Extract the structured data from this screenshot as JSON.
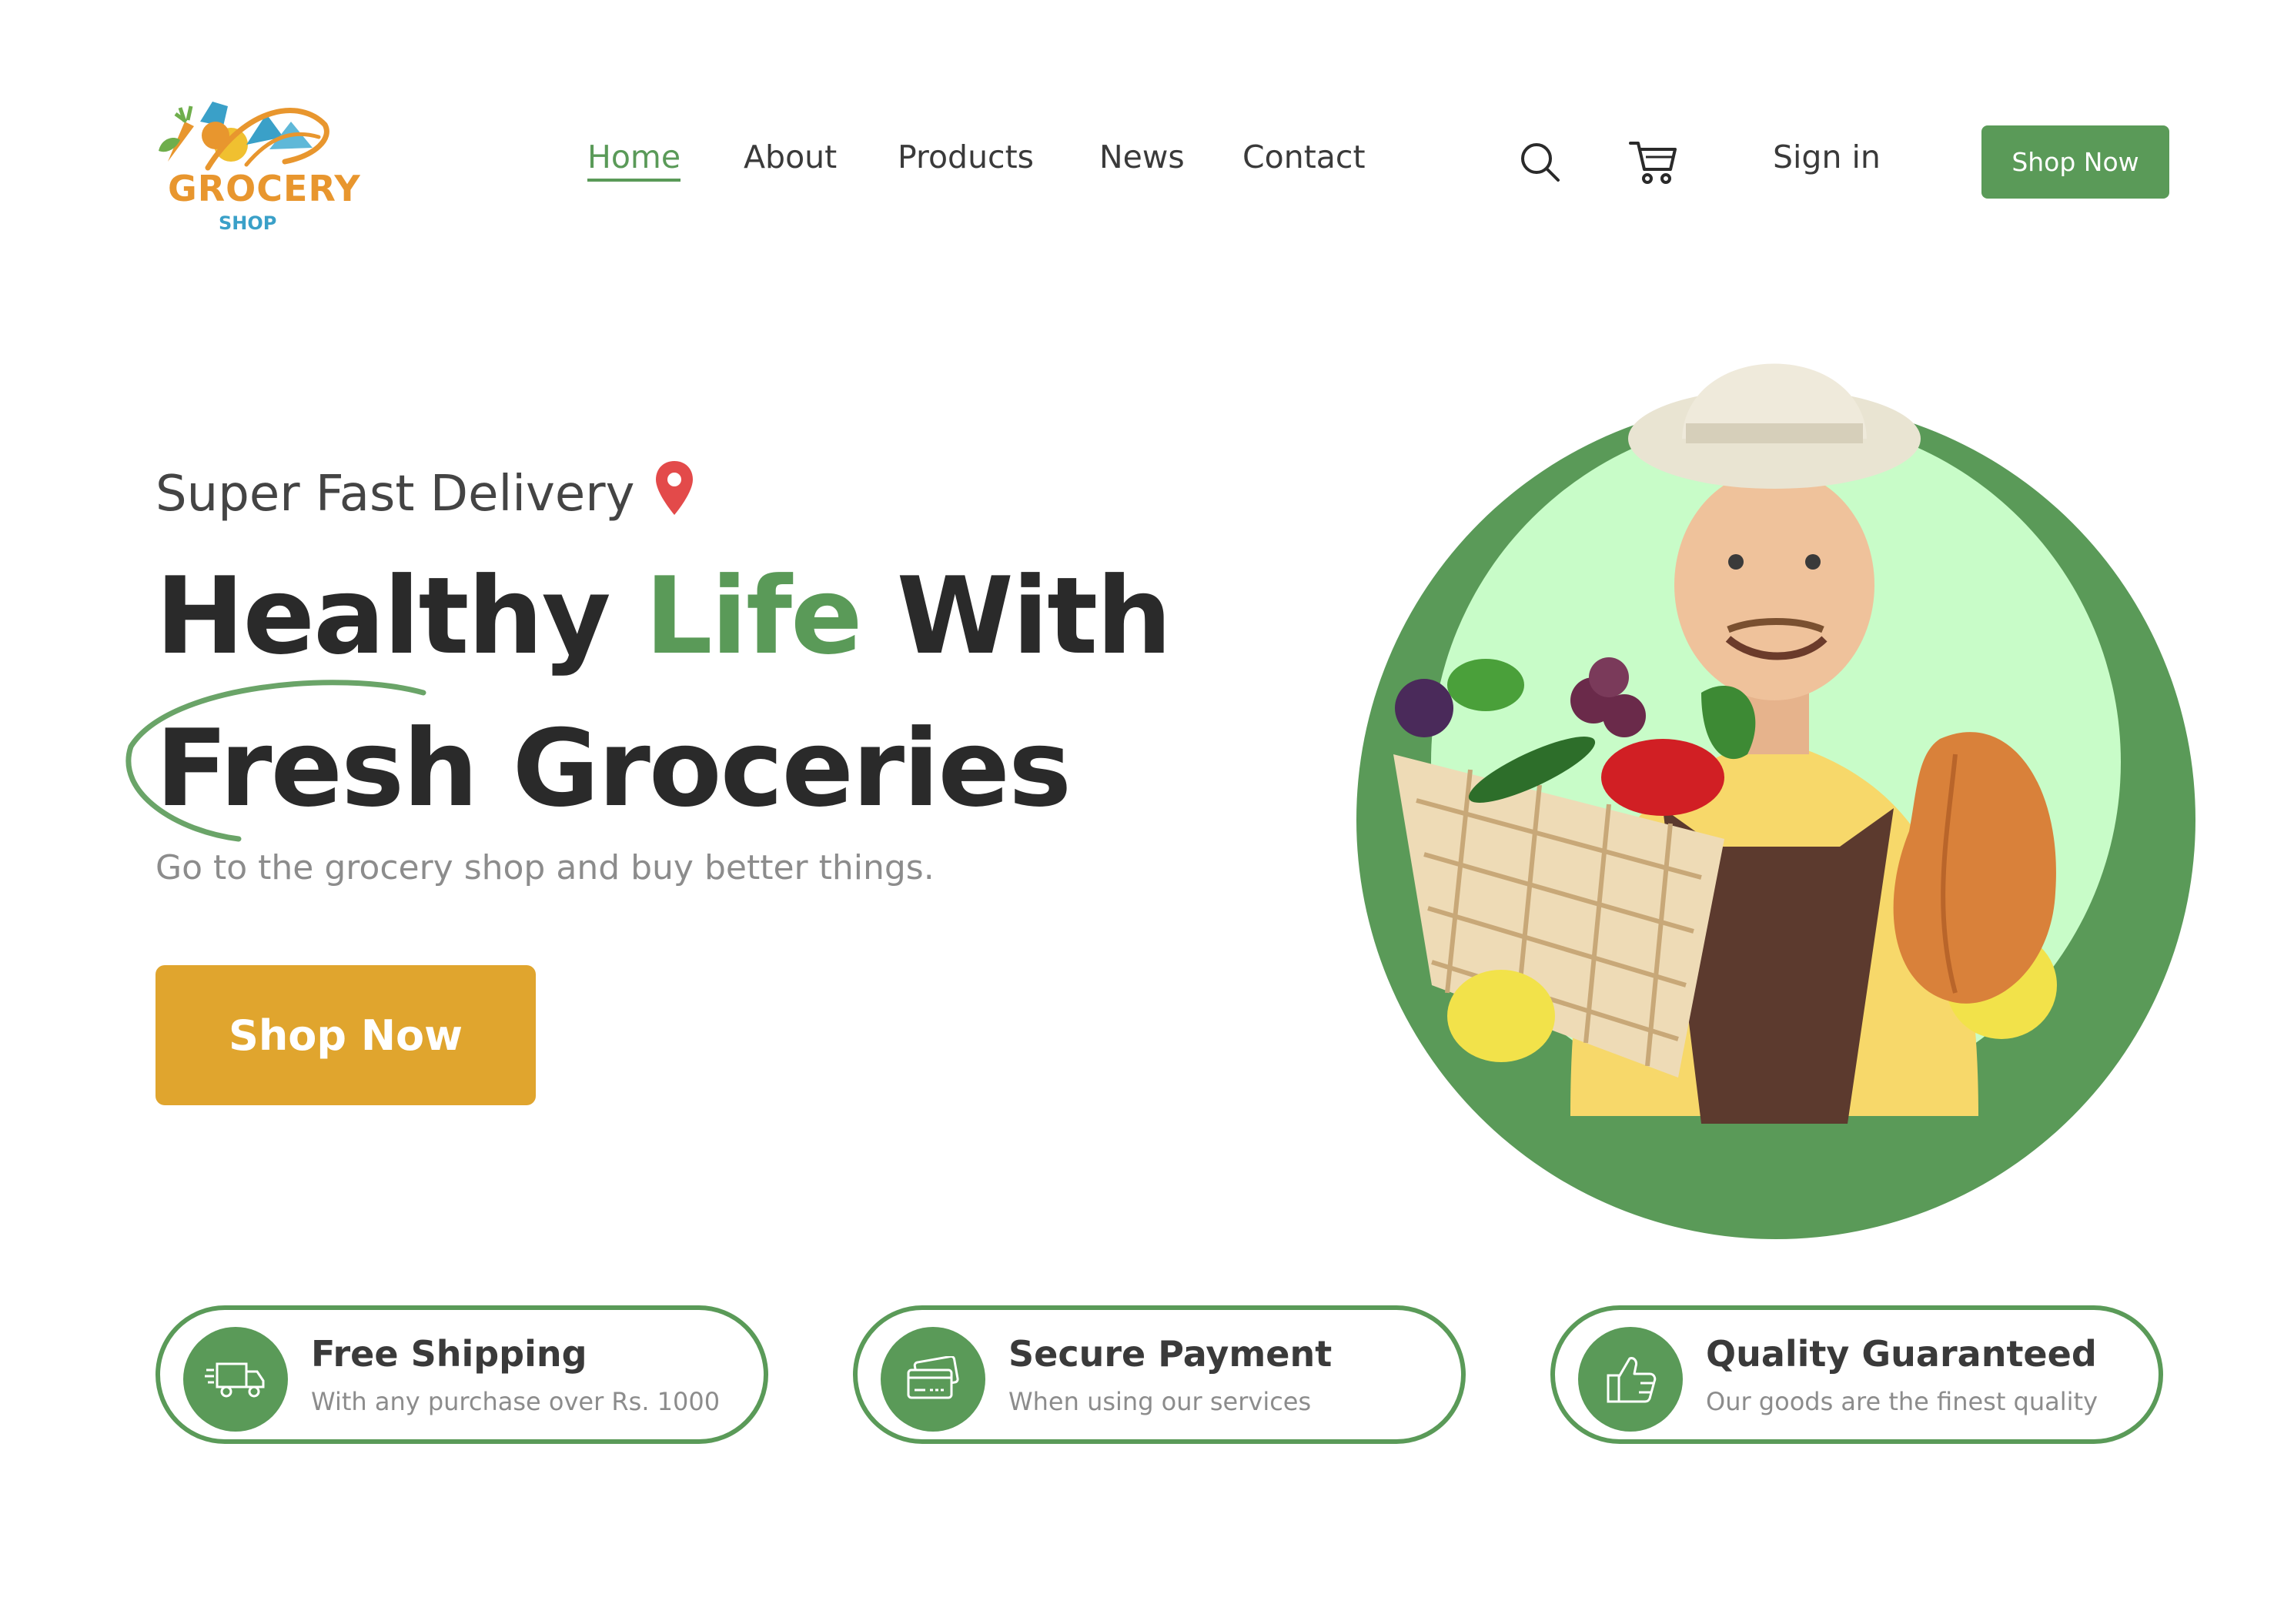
{
  "brand": {
    "logo_word": "GROCERY",
    "logo_sub": "SHOP",
    "logo_colors": {
      "orange": "#e8962e",
      "blue": "#3aa0c8",
      "green": "#6fae4c"
    }
  },
  "nav": {
    "items": [
      {
        "label": "Home",
        "active": true
      },
      {
        "label": "About",
        "active": false
      },
      {
        "label": "Products",
        "active": false
      },
      {
        "label": "News",
        "active": false
      },
      {
        "label": "Contact",
        "active": false
      }
    ],
    "icons": [
      "search-icon",
      "cart-icon"
    ],
    "signin_label": "Sign in",
    "shop_button_label": "Shop Now"
  },
  "hero": {
    "tagline": "Super Fast Delivery",
    "tagline_icon": "location-pin-icon",
    "headline_line1_part1": "Healthy ",
    "headline_line1_highlight": "Life",
    "headline_line1_part2": " With",
    "headline_line2": "Fresh Groceries",
    "subline": "Go to the grocery shop and buy better things.",
    "button_label": "Shop Now",
    "image_subject": "farmer-with-vegetable-basket"
  },
  "features": [
    {
      "icon": "delivery-truck-icon",
      "title": "Free Shipping",
      "description": "With any purchase over Rs. 1000"
    },
    {
      "icon": "credit-card-icon",
      "title": "Secure Payment",
      "description": "When using our services"
    },
    {
      "icon": "thumbs-up-icon",
      "title": "Quality Guaranteed",
      "description": "Our goods are the finest quality"
    }
  ],
  "colors": {
    "primary_green": "#5a9a58",
    "accent_yellow": "#e0a52e",
    "light_green": "#c8fcc8",
    "text_dark": "#2a2a2a",
    "text_muted": "#8c8c8c"
  }
}
